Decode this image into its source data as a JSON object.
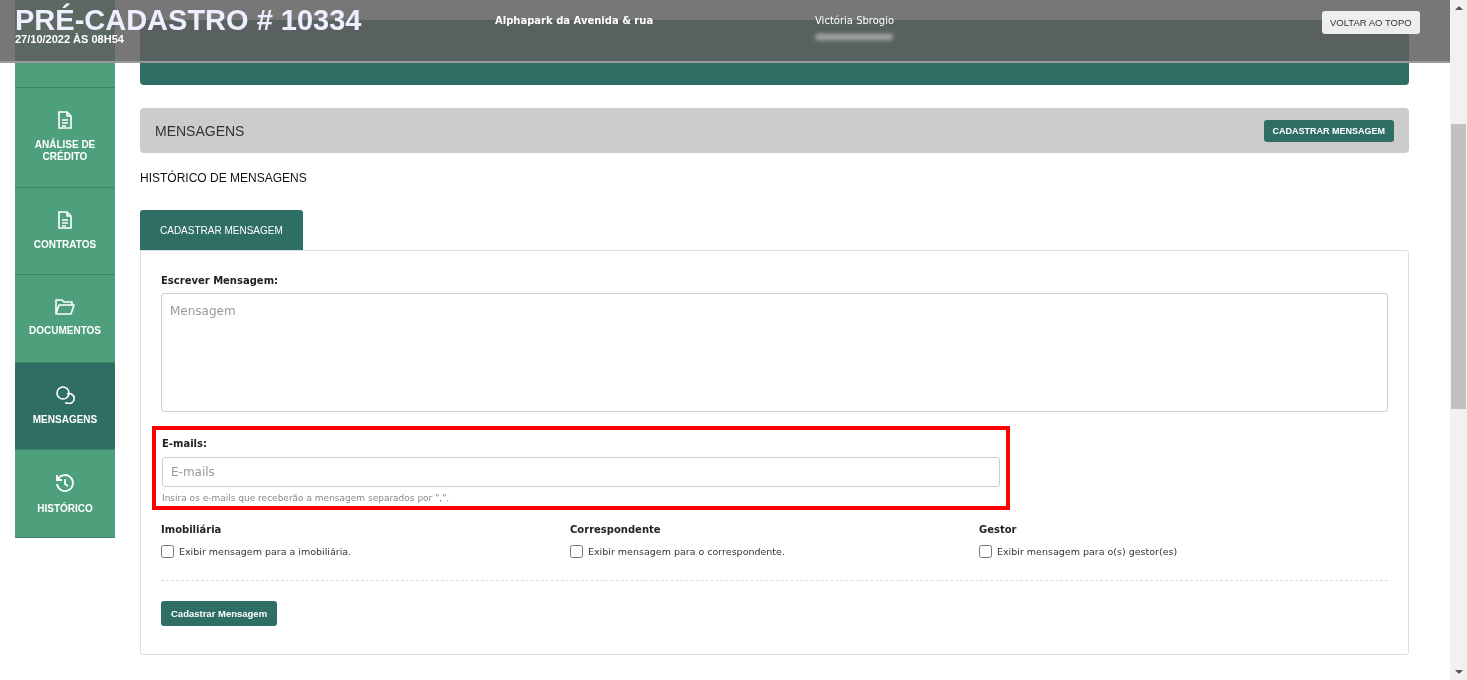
{
  "top_bar": {
    "title": "PRÉ-CADASTRO # 10334",
    "date": "27/10/2022 ÀS 08H54",
    "project": "Alphapark da Avenida & rua",
    "person": "Victória Sbrogio",
    "back_to_top": "VOLTAR AO TOPO"
  },
  "sidebar": {
    "items": [
      {
        "label": "ANÁLISE DE CRÉDITO",
        "selected": false
      },
      {
        "label": "CONTRATOS",
        "selected": false
      },
      {
        "label": "DOCUMENTOS",
        "selected": false
      },
      {
        "label": "MENSAGENS",
        "selected": true
      },
      {
        "label": "HISTÓRICO",
        "selected": false
      }
    ]
  },
  "section": {
    "title": "MENSAGENS",
    "button": "CADASTRAR MENSAGEM"
  },
  "history_heading": "HISTÓRICO DE MENSAGENS",
  "tabs": [
    {
      "label": "CADASTRAR MENSAGEM",
      "selected": true
    }
  ],
  "form": {
    "message_label": "Escrever Mensagem:",
    "message_placeholder": "Mensagem",
    "emails_label": "E-mails:",
    "emails_placeholder": "E-mails",
    "emails_help": "Insira os e-mails que receberão a mensagem separados por \",\".",
    "emails_highlighted": true,
    "visibility": [
      {
        "heading": "Imobiliária",
        "label": "Exibir mensagem para a imobiliária.",
        "checked": false
      },
      {
        "heading": "Correspondente",
        "label": "Exibir mensagem para o correspondente.",
        "checked": false
      },
      {
        "heading": "Gestor",
        "label": "Exibir mensagem para o(s) gestor(es)",
        "checked": false
      }
    ],
    "submit": "Cadastrar Mensagem"
  }
}
